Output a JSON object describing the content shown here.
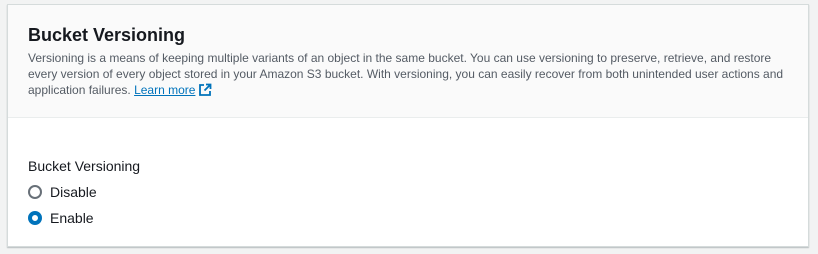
{
  "section": {
    "title": "Bucket Versioning",
    "description": "Versioning is a means of keeping multiple variants of an object in the same bucket. You can use versioning to preserve, retrieve, and restore every version of every object stored in your Amazon S3 bucket. With versioning, you can easily recover from both unintended user actions and application failures.",
    "learn_more": "Learn more",
    "learn_more_icon": "external-link-icon"
  },
  "field": {
    "label": "Bucket Versioning",
    "options": [
      {
        "label": "Disable",
        "selected": false
      },
      {
        "label": "Enable",
        "selected": true
      }
    ]
  },
  "colors": {
    "accent": "#0073bb",
    "text": "#16191f",
    "muted": "#545b64"
  }
}
